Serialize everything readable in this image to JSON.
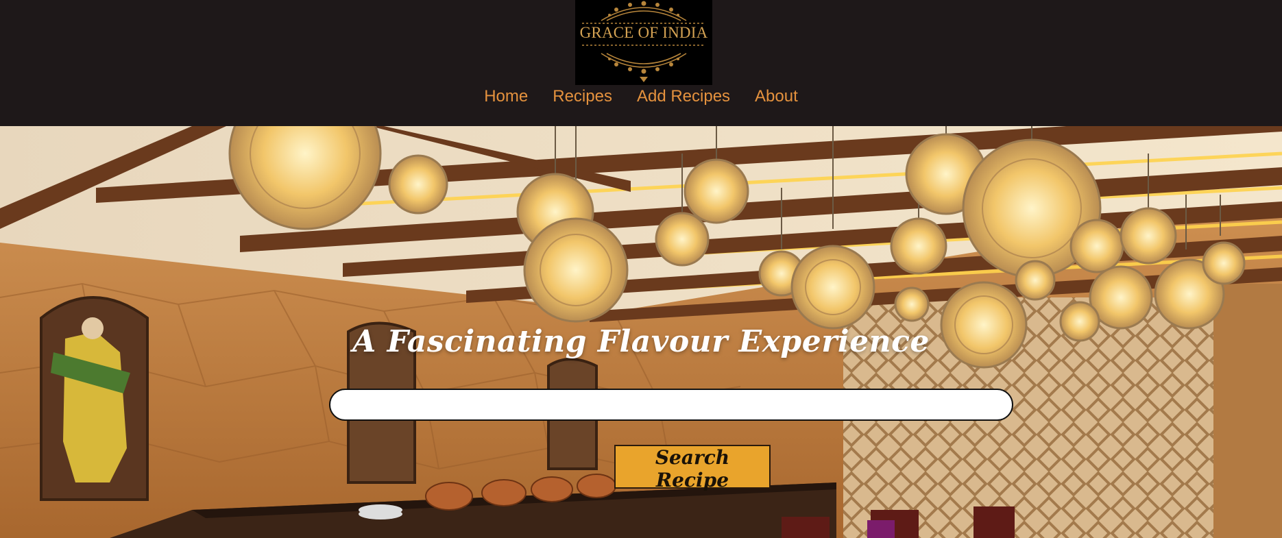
{
  "header": {
    "logo_text": "GRACE OF INDIA",
    "background": "#1e1819",
    "logo_background": "#000000",
    "logo_color": "#d4a253"
  },
  "nav": {
    "items": [
      {
        "label": "Home"
      },
      {
        "label": "Recipes"
      },
      {
        "label": "Add Recipes"
      },
      {
        "label": "About"
      }
    ],
    "color": "#e5923e"
  },
  "hero": {
    "title": "A Fascinating Flavour Experience",
    "search": {
      "value": "",
      "placeholder": ""
    },
    "search_button_label": "Search Recipe",
    "button_color": "#e9a42c"
  }
}
